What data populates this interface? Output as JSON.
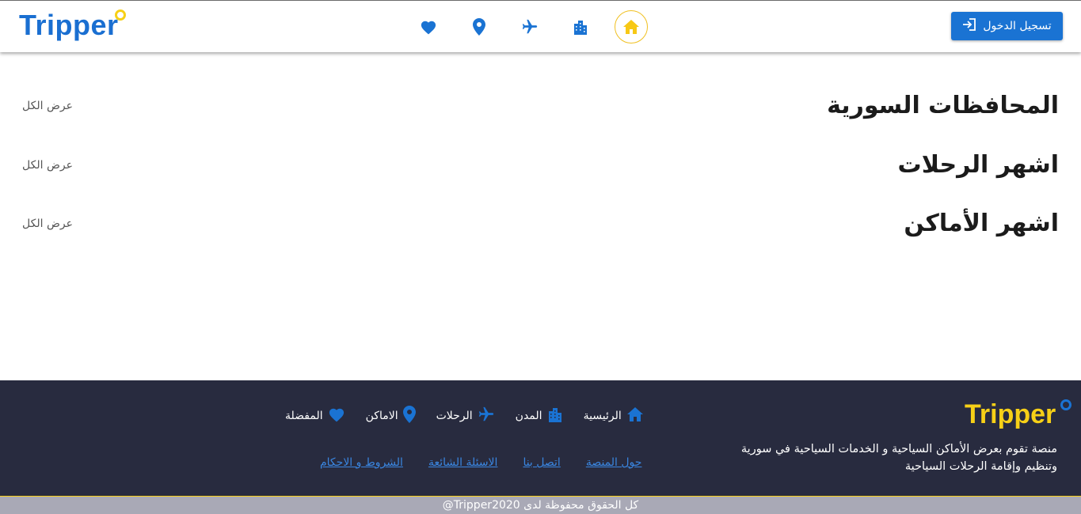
{
  "header": {
    "logo": "Tripper",
    "login_label": "تسجيل الدخول",
    "nav": [
      {
        "icon": "heart-icon"
      },
      {
        "icon": "location-pin-icon"
      },
      {
        "icon": "airplane-icon"
      },
      {
        "icon": "city-buildings-icon"
      },
      {
        "icon": "home-icon",
        "active": true
      }
    ]
  },
  "sections": [
    {
      "title": "المحافظات السورية",
      "view_all": "عرض الكل"
    },
    {
      "title": "اشهر الرحلات",
      "view_all": "عرض الكل"
    },
    {
      "title": "اشهر الأماكن",
      "view_all": "عرض الكل"
    }
  ],
  "footer": {
    "logo": "Tripper",
    "description": "منصة تقوم بعرض الأماكن السياحية و الخدمات السياحية في سورية وتنظيم وإقامة الرحلات السياحية",
    "nav": [
      {
        "label": "الرئيسية",
        "icon": "home-icon"
      },
      {
        "label": "المدن",
        "icon": "city-buildings-icon"
      },
      {
        "label": "الرحلات",
        "icon": "airplane-icon"
      },
      {
        "label": "الاماكن",
        "icon": "location-pin-icon"
      },
      {
        "label": "المفضلة",
        "icon": "heart-icon"
      }
    ],
    "links": [
      "حول المنصة",
      "اتصل بنا",
      "الاسئلة الشائعة",
      "الشروط و الاحكام"
    ],
    "copyright": "كل الحقوق محفوظة لدى Tripper2020@"
  },
  "colors": {
    "brand_blue": "#1a73d3",
    "brand_yellow": "#f7d017",
    "footer_bg": "#282b3f"
  }
}
